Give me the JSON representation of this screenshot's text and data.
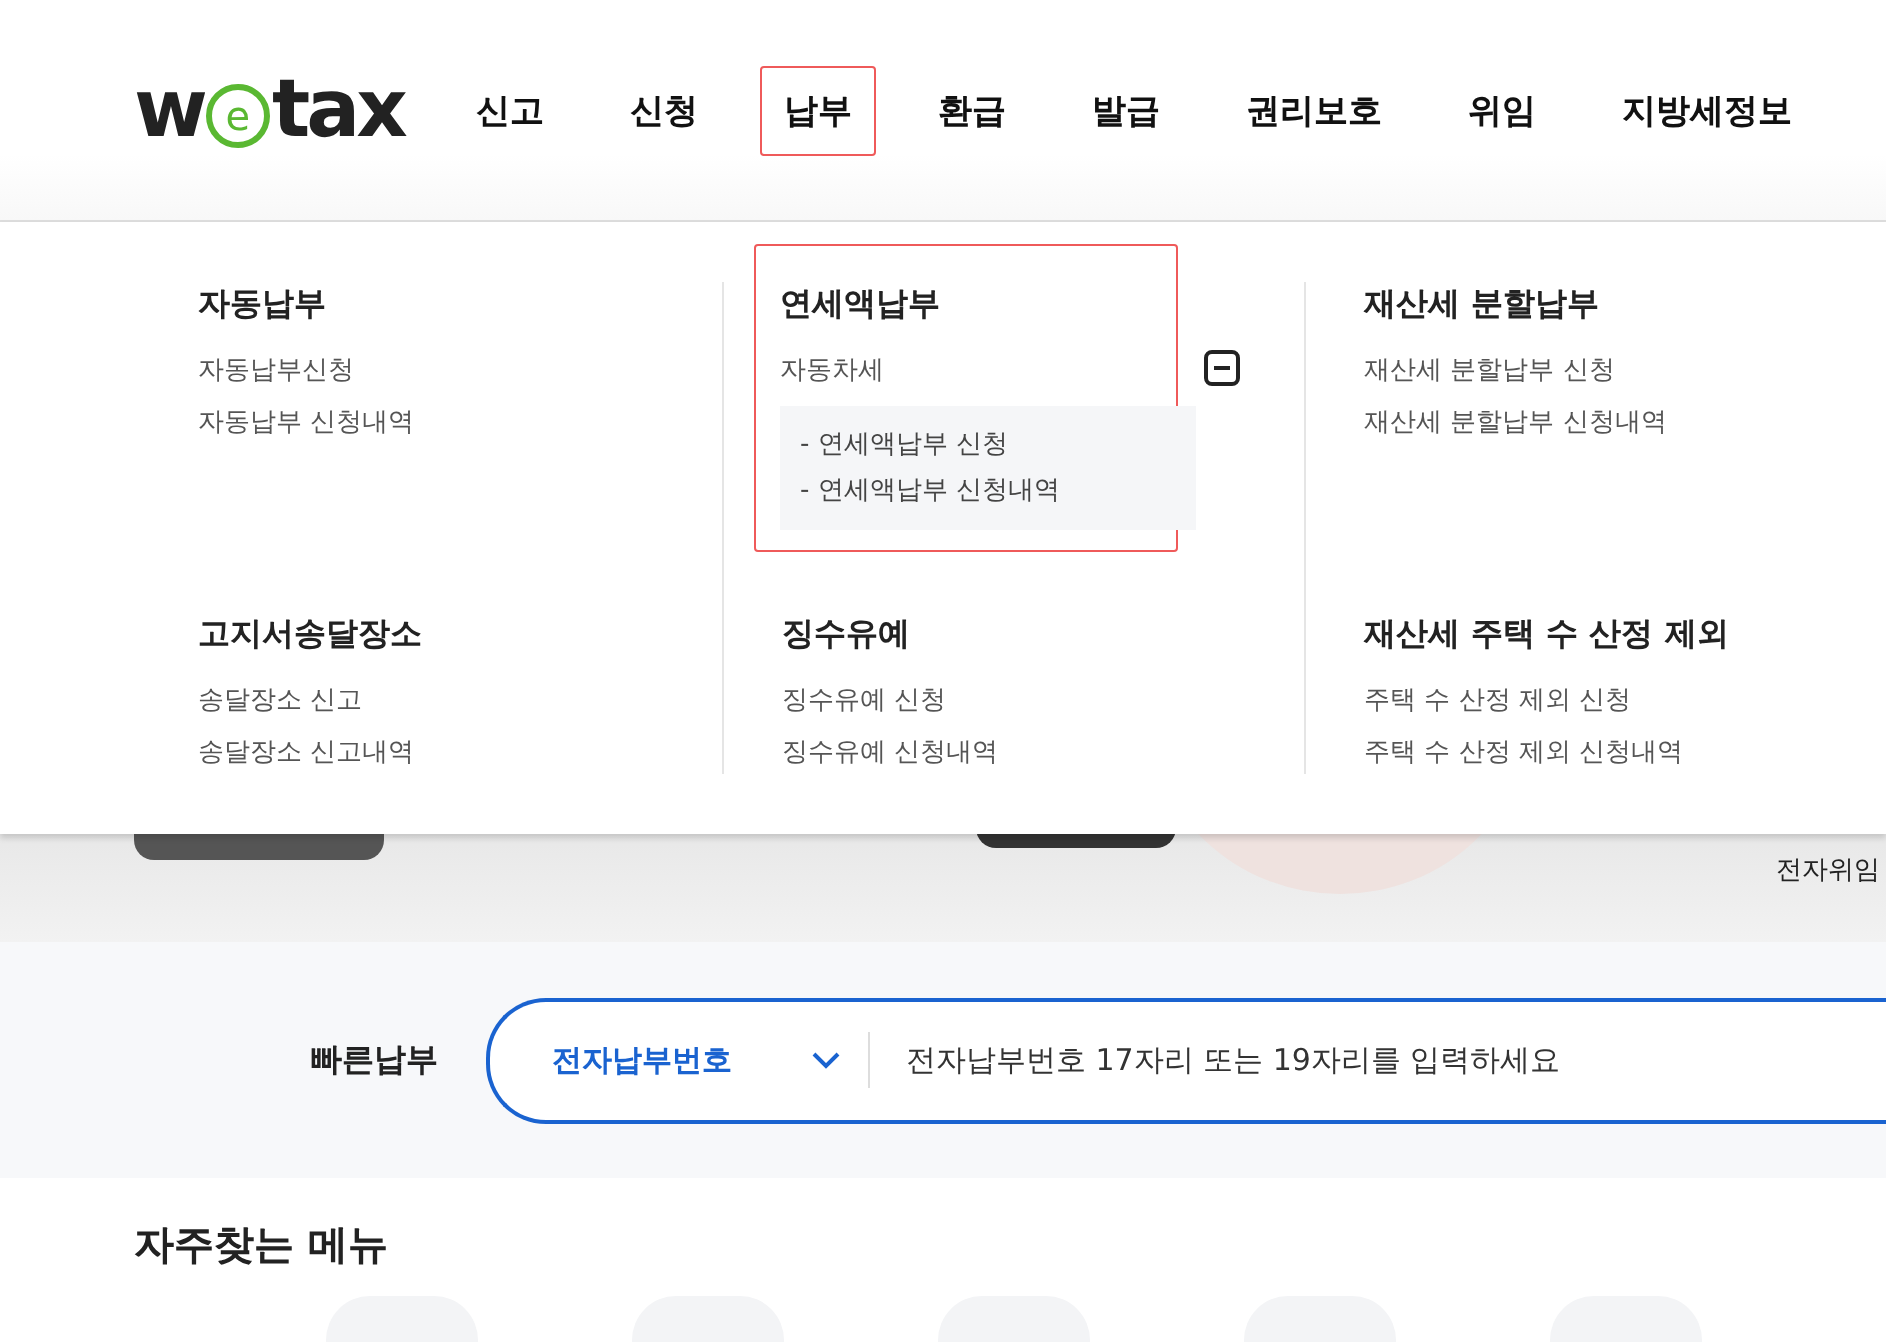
{
  "logo": {
    "before": "w",
    "mark": "e",
    "after": "tax"
  },
  "nav": [
    {
      "label": "신고",
      "selected": false
    },
    {
      "label": "신청",
      "selected": false
    },
    {
      "label": "납부",
      "selected": true
    },
    {
      "label": "환급",
      "selected": false
    },
    {
      "label": "발급",
      "selected": false
    },
    {
      "label": "권리보호",
      "selected": false
    },
    {
      "label": "위임",
      "selected": false
    },
    {
      "label": "지방세정보",
      "selected": false
    }
  ],
  "menu_groups": [
    {
      "title": "자동납부",
      "highlighted": false,
      "items": [
        {
          "label": "자동납부신청"
        },
        {
          "label": "자동납부 신청내역"
        }
      ]
    },
    {
      "title": "연세액납부",
      "highlighted": true,
      "items": [
        {
          "label": "자동차세",
          "expanded": true,
          "children": [
            {
              "bullet": "-",
              "label": "연세액납부 신청"
            },
            {
              "bullet": "-",
              "label": "연세액납부 신청내역"
            }
          ]
        }
      ]
    },
    {
      "title": "재산세 분할납부",
      "highlighted": false,
      "items": [
        {
          "label": "재산세 분할납부 신청"
        },
        {
          "label": "재산세 분할납부 신청내역"
        }
      ]
    },
    {
      "title": "고지서송달장소",
      "highlighted": false,
      "items": [
        {
          "label": "송달장소 신고"
        },
        {
          "label": "송달장소 신고내역"
        }
      ]
    },
    {
      "title": "징수유예",
      "highlighted": false,
      "items": [
        {
          "label": "징수유예 신청"
        },
        {
          "label": "징수유예 신청내역"
        }
      ]
    },
    {
      "title": "재산세 주택 수 산정 제외",
      "highlighted": false,
      "items": [
        {
          "label": "주택 수 산정 제외 신청"
        },
        {
          "label": "주택 수 산정 제외 신청내역"
        }
      ]
    }
  ],
  "banner": {
    "caption": "전자위임"
  },
  "quick_pay": {
    "label": "빠른납부",
    "select": "전자납부번호",
    "placeholder": "전자납부번호 17자리 또는 19자리를 입력하세요"
  },
  "frequent_menu": {
    "title": "자주찾는 메뉴"
  }
}
